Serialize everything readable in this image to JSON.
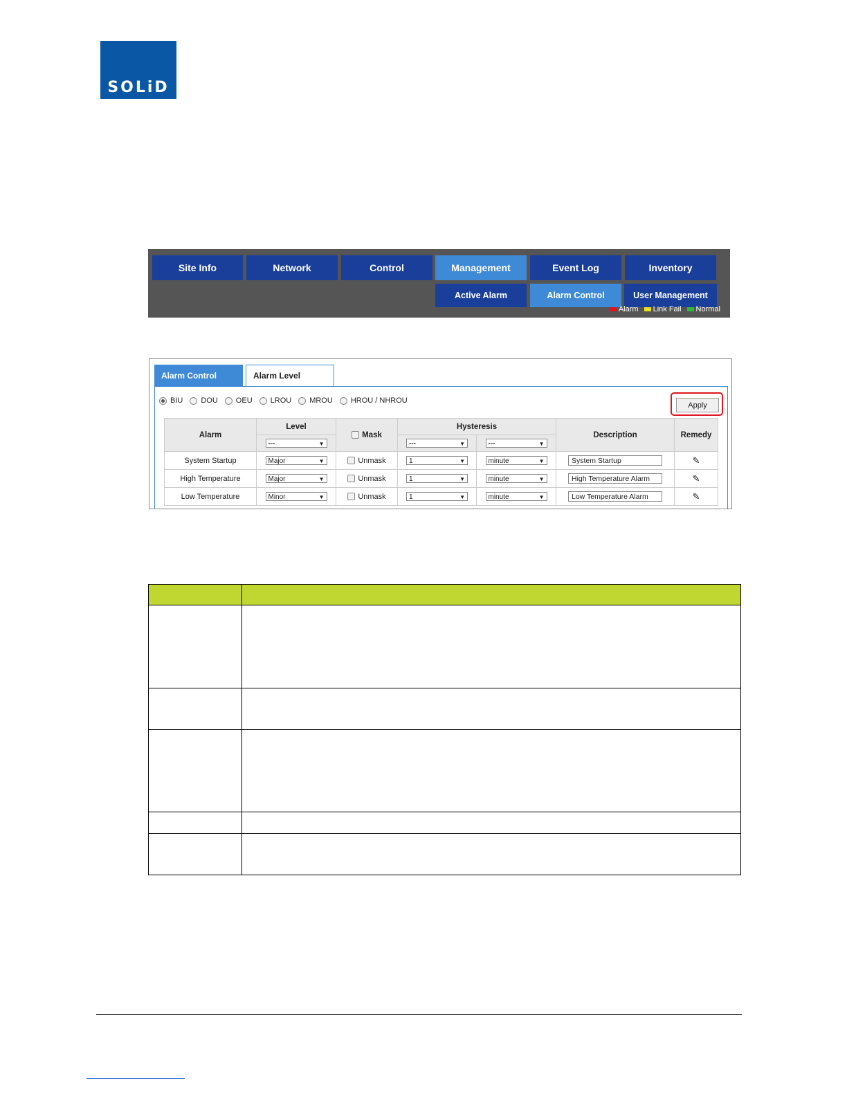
{
  "logo": {
    "text": "SOLiD"
  },
  "nav": {
    "main_tabs": [
      "Site Info",
      "Network",
      "Control",
      "Management",
      "Event Log",
      "Inventory"
    ],
    "active_main": "Management",
    "sub_tabs": [
      "Active Alarm",
      "Alarm Control",
      "User Management"
    ],
    "active_sub": "Alarm Control",
    "legend": [
      {
        "label": "Alarm",
        "color": "#e0141e"
      },
      {
        "label": "Link Fail",
        "color": "#e8e020"
      },
      {
        "label": "Normal",
        "color": "#2fb83a"
      }
    ]
  },
  "panel": {
    "tabs": [
      "Alarm Control",
      "Alarm Level"
    ],
    "units": [
      "BIU",
      "DOU",
      "OEU",
      "LROU",
      "MROU",
      "HROU / NHROU"
    ],
    "selected_unit": "BIU",
    "apply_label": "Apply",
    "headers": {
      "alarm": "Alarm",
      "level": "Level",
      "mask": "Mask",
      "hysteresis": "Hysteresis",
      "description": "Description",
      "remedy": "Remedy"
    },
    "filter": {
      "level": "---",
      "hyst_value": "---",
      "hyst_unit": "---"
    },
    "rows": [
      {
        "alarm": "System Startup",
        "level": "Major",
        "mask": "Unmask",
        "hyst_value": "1",
        "hyst_unit": "minute",
        "description": "System Startup"
      },
      {
        "alarm": "High Temperature",
        "level": "Major",
        "mask": "Unmask",
        "hyst_value": "1",
        "hyst_unit": "minute",
        "description": "High Temperature Alarm"
      },
      {
        "alarm": "Low Temperature",
        "level": "Minor",
        "mask": "Unmask",
        "hyst_value": "1",
        "hyst_unit": "minute",
        "description": "Low Temperature Alarm"
      }
    ]
  },
  "colors": {
    "nav_button": "#1a3f9a",
    "nav_active": "#3f8ad6",
    "table_header": "#c0d731",
    "highlight": "#e0141e",
    "logo": "#0a57a5"
  }
}
